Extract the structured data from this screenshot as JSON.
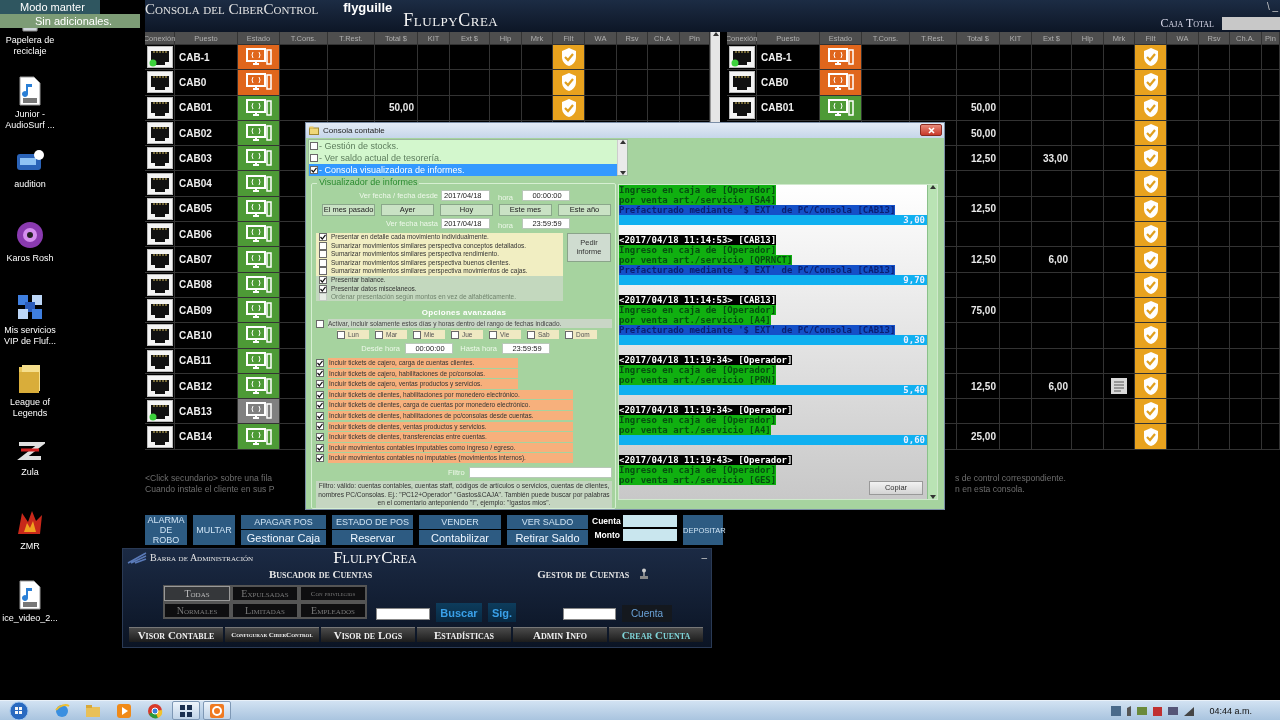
{
  "desktop": {
    "notice": {
      "lines": [
        "Modo manter",
        "Sin adicionales."
      ]
    },
    "icons": [
      {
        "label": "Papelera de reciclaje",
        "kind": "bin"
      },
      {
        "label": "Junior - AudioSurf ...",
        "kind": "audio"
      },
      {
        "label": "audition",
        "kind": "app"
      },
      {
        "label": "Karos Rosh",
        "kind": "disc"
      },
      {
        "label": "Mis servicios VIP de Fluf...",
        "kind": "grid"
      },
      {
        "label": "League of Legends",
        "kind": "folder"
      },
      {
        "label": "Zula",
        "kind": "stripe"
      },
      {
        "label": "ZMR",
        "kind": "flame"
      },
      {
        "label": "ice_video_2...",
        "kind": "audio"
      }
    ]
  },
  "main": {
    "title": "Consola del CiberControl",
    "user": "flyguille",
    "brand": "FlulpyCrea",
    "cash_label": "Caja Total",
    "window_controls": "\\ _",
    "tables": [
      {
        "columns": [
          "Conexión",
          "Puesto",
          "Estado",
          "T.Cons.",
          "T.Rest.",
          "Total $",
          "KIT",
          "Ext $",
          "Hlp",
          "Mrk",
          "Filt",
          "WA",
          "Rsv",
          "Ch.A.",
          "Pin"
        ],
        "rows": [
          {
            "puesto": "CAB-1",
            "color": "#e0661c",
            "connected": true,
            "filt": true
          },
          {
            "puesto": "CAB0",
            "color": "#e0661c",
            "connected": false,
            "filt": true
          },
          {
            "puesto": "CAB01",
            "color": "#4d9a36",
            "connected": false,
            "total": "50,00",
            "filt": true
          },
          {
            "puesto": "CAB02",
            "color": "#4d9a36",
            "connected": false
          },
          {
            "puesto": "CAB03",
            "color": "#4d9a36",
            "connected": false
          },
          {
            "puesto": "CAB04",
            "color": "#4d9a36",
            "connected": false
          },
          {
            "puesto": "CAB05",
            "color": "#4d9a36",
            "connected": false
          },
          {
            "puesto": "CAB06",
            "color": "#4d9a36",
            "connected": false
          },
          {
            "puesto": "CAB07",
            "color": "#4d9a36",
            "connected": false
          },
          {
            "puesto": "CAB08",
            "color": "#4d9a36",
            "connected": false
          },
          {
            "puesto": "CAB09",
            "color": "#4d9a36",
            "connected": false
          },
          {
            "puesto": "CAB10",
            "color": "#4d9a36",
            "connected": false
          },
          {
            "puesto": "CAB11",
            "color": "#4d9a36",
            "connected": false
          },
          {
            "puesto": "CAB12",
            "color": "#4d9a36",
            "connected": false
          },
          {
            "puesto": "CAB13",
            "color": "#808080",
            "connected": true
          },
          {
            "puesto": "CAB14",
            "color": "#4d9a36",
            "connected": false
          }
        ]
      },
      {
        "columns": [
          "Conexión",
          "Puesto",
          "Estado",
          "T.Cons.",
          "T.Rest.",
          "Total $",
          "KIT",
          "Ext $",
          "Hlp",
          "Mrk",
          "Filt",
          "WA",
          "Rsv",
          "Ch.A.",
          "Pin"
        ],
        "rows": [
          {
            "puesto": "CAB-1",
            "color": "#e0661c",
            "connected": true,
            "filt": true
          },
          {
            "puesto": "CAB0",
            "color": "#e0661c",
            "connected": false,
            "filt": true
          },
          {
            "puesto": "CAB01",
            "color": "#4d9a36",
            "connected": false,
            "total": "50,00",
            "filt": true
          },
          {
            "total": "50,00",
            "filt": true
          },
          {
            "total": "12,50",
            "ext": "33,00",
            "filt": true
          },
          {
            "filt": true
          },
          {
            "total": "12,50",
            "filt": true
          },
          {
            "filt": true
          },
          {
            "total": "12,50",
            "ext": "6,00",
            "filt": true
          },
          {
            "filt": true
          },
          {
            "total": "75,00",
            "filt": true
          },
          {
            "filt": true
          },
          {
            "filt": true
          },
          {
            "total": "12,50",
            "ext": "6,00",
            "mrk": true,
            "filt": true
          },
          {
            "filt": true
          },
          {
            "total": "25,00",
            "filt": true
          }
        ]
      }
    ],
    "hints": {
      "left": [
        "<Click secundario> sobre una fila",
        "Cuando instale el cliente en sus P"
      ],
      "right": [
        "s de control correspondiente.",
        "n en esta consola."
      ]
    },
    "actions": [
      {
        "kind": "single",
        "label": "ALARMA DE ROBO"
      },
      {
        "kind": "single",
        "label": "MULTAR"
      },
      {
        "kind": "double",
        "top": "APAGAR POS",
        "bottom": "Gestionar Caja"
      },
      {
        "kind": "double",
        "top": "ESTADO DE POS",
        "bottom": "Reservar"
      },
      {
        "kind": "double",
        "top": "VENDER",
        "bottom": "Contabilizar"
      },
      {
        "kind": "double",
        "top": "VER SALDO",
        "bottom": "Retirar Saldo"
      }
    ],
    "deposit": {
      "fields": [
        {
          "label": "Cuenta"
        },
        {
          "label": "Monto"
        }
      ],
      "button": "DEPOSITAR"
    }
  },
  "dialog": {
    "title": "Consola contable",
    "modules": [
      {
        "label": "- Gestión de stocks.",
        "checked": false,
        "selected": false
      },
      {
        "label": "- Ver saldo actual de tesorería.",
        "checked": false,
        "selected": false
      },
      {
        "label": "- Consola visualizadora de informes.",
        "checked": true,
        "selected": true
      }
    ],
    "report": {
      "title": "Visualizador de informes",
      "from_label": "Ver fecha / fecha desde",
      "from_date": "2017/04/18",
      "from_hour_label": "hora",
      "from_time": "00:00:00",
      "presets": [
        "El mes pasado",
        "Ayer",
        "Hoy",
        "Este mes",
        "Este año"
      ],
      "to_label": "Ver fecha hasta",
      "to_date": "2017/04/18",
      "to_hour_label": "hora",
      "to_time": "23:59:59",
      "options": [
        {
          "label": "Presentar en detalle cada movimiento individualmente.",
          "kind": "mode",
          "checked": true,
          "disabled": false
        },
        {
          "label": "Sumarizar movimientos similares perspectiva conceptos detallados.",
          "kind": "mode",
          "checked": false,
          "disabled": false
        },
        {
          "label": "Sumarizar movimientos similares perspectiva rendimiento.",
          "kind": "mode",
          "checked": false,
          "disabled": false
        },
        {
          "label": "Sumarizar movimientos similares perspectiva buenos clientes.",
          "kind": "mode",
          "checked": false,
          "disabled": false
        },
        {
          "label": "Sumarizar movimientos similares perspectiva movimientos de cajas.",
          "kind": "mode",
          "checked": false,
          "disabled": false
        },
        {
          "label": "Presentar balance.",
          "kind": "extra",
          "checked": true,
          "disabled": false
        },
        {
          "label": "Presentar datos miscelaneos.",
          "kind": "extra",
          "checked": true,
          "disabled": false
        },
        {
          "label": "Ordenar presentación según montos en vez de alfabéticamente.",
          "kind": "extra",
          "checked": false,
          "disabled": true
        }
      ],
      "request_button": "Pedir informe"
    },
    "advanced": {
      "title": "Opciones avanzadas",
      "activate": {
        "label": "Activar, incluir solamente estos días y horas dentro del rango de fechas indicado.",
        "checked": false
      },
      "days": [
        {
          "label": "Lun",
          "checked": false
        },
        {
          "label": "Mar",
          "checked": false
        },
        {
          "label": "Mie",
          "checked": false
        },
        {
          "label": "Jue",
          "checked": false
        },
        {
          "label": "Vie",
          "checked": false
        },
        {
          "label": "Sab",
          "checked": false
        },
        {
          "label": "Dom",
          "checked": false
        }
      ],
      "from_label": "Desde hora",
      "from_time": "00:00:00",
      "to_label": "Hasta hora",
      "to_time": "23:59:59",
      "includes": [
        {
          "label": "Incluir tickets de cajero, carga de cuentas clientes.",
          "kind": "cashier",
          "checked": true
        },
        {
          "label": "Incluir tickets de cajero, habilitaciones de pc/consolas.",
          "kind": "cashier",
          "checked": true
        },
        {
          "label": "Incluir tickets de cajero, ventas productos y servicios.",
          "kind": "cashier",
          "checked": true
        },
        {
          "label": "Incluir tickets de clientes, habilitaciones por monedero electrónico.",
          "kind": "client",
          "checked": true
        },
        {
          "label": "Incluir tickets de clientes, carga de cuentas por monedero electrónico.",
          "kind": "client",
          "checked": true
        },
        {
          "label": "Incluir tickets de clientes, habilitaciones de pc/consolas desde cuentas.",
          "kind": "client",
          "checked": true
        },
        {
          "label": "Incluir tickets de clientes, ventas productos y servicios.",
          "kind": "client",
          "checked": true
        },
        {
          "label": "Incluir tickets de clientes, transferencias entre cuentas.",
          "kind": "client",
          "checked": true
        },
        {
          "label": "Incluir movimientos contables imputables como ingreso / egreso.",
          "kind": "client",
          "checked": true
        },
        {
          "label": "Incluir movimientos contables no imputables (movimientos internos).",
          "kind": "client",
          "checked": true
        }
      ]
    },
    "filter_label": "Filtro",
    "help": "Filtro: válido: cuentas contables, cuentas staff, códigos de artículos o servicios, cuentas de clientes, nombres PC/Consolas. Ej.: \"PC12+Operador\" \"Gastos&CAJA\". También puede buscar por palabras en el comentario anteponiendo \"!\", ejemplo: \"!gastos mios\".",
    "log": [
      {
        "lines": [
          "Ingreso en caja de [Operador]",
          "por venta art./servicio [SA4]"
        ],
        "prefact": "Prefacturado mediante '$ EXT' de PC/Consola [CAB13]",
        "amount": "3,00"
      },
      {
        "header": "<2017/04/18 11:14:53> [CAB13]",
        "lines": [
          "Ingreso en caja de [Operador]",
          "por venta art./servicio [QPRNCT]"
        ],
        "prefact": "Prefacturado mediante '$ EXT' de PC/Consola [CAB13]",
        "amount": "9,70"
      },
      {
        "header": "<2017/04/18 11:14:53> [CAB13]",
        "lines": [
          "Ingreso en caja de [Operador]",
          "por venta art./servicio [A4]"
        ],
        "prefact": "Prefacturado mediante '$ EXT' de PC/Consola [CAB13]",
        "amount": "0,30"
      },
      {
        "header": "<2017/04/18 11:19:34> [Operador]",
        "lines": [
          "Ingreso en caja de [Operador]",
          "por venta art./servicio [PRN]"
        ],
        "amount": "5,40"
      },
      {
        "header": "<2017/04/18 11:19:34> [Operador]",
        "lines": [
          "Ingreso en caja de [Operador]",
          "por venta art./servicio [A4]"
        ],
        "amount": "0,60"
      },
      {
        "header": "<2017/04/18 11:19:43> [Operador]",
        "lines": [
          "Ingreso en caja de [Operador]",
          "por venta art./servicio [GES]"
        ]
      }
    ],
    "copy_button": "Copiar"
  },
  "admin": {
    "title": "Barra de Administración",
    "brand": "FlulpyCrea",
    "minimize": "–",
    "search_title": "Buscador de Cuentas",
    "manager_title": "Gestor de Cuentas",
    "filters": [
      {
        "label": "Todas",
        "selected": true
      },
      {
        "label": "Expulsadas",
        "selected": false
      },
      {
        "label": "Con privilegios",
        "selected": false
      },
      {
        "label": "Normales",
        "selected": false
      },
      {
        "label": "Limitadas",
        "selected": false
      },
      {
        "label": "Empleados",
        "selected": false
      }
    ],
    "search_button": "Buscar",
    "next_button": "Sig.",
    "account_button": "Cuenta",
    "tabs": [
      {
        "label": "Visor Contable",
        "kind": "tab"
      },
      {
        "label": "Configurar CiberControl",
        "kind": "small"
      },
      {
        "label": "Visor de Logs",
        "kind": "tab"
      },
      {
        "label": "Estadísticas",
        "kind": "tab"
      },
      {
        "label": "Admin Info",
        "kind": "tab"
      },
      {
        "label": "Crear Cuenta",
        "kind": "create"
      }
    ]
  },
  "taskbar": {
    "apps": [
      {
        "kind": "browser",
        "active": false
      },
      {
        "kind": "folder",
        "active": false
      },
      {
        "kind": "media",
        "active": false
      },
      {
        "kind": "chrome",
        "active": false
      },
      {
        "kind": "grid",
        "active": true
      },
      {
        "kind": "ring",
        "active": true
      }
    ],
    "clock": "04:44 a.m."
  }
}
